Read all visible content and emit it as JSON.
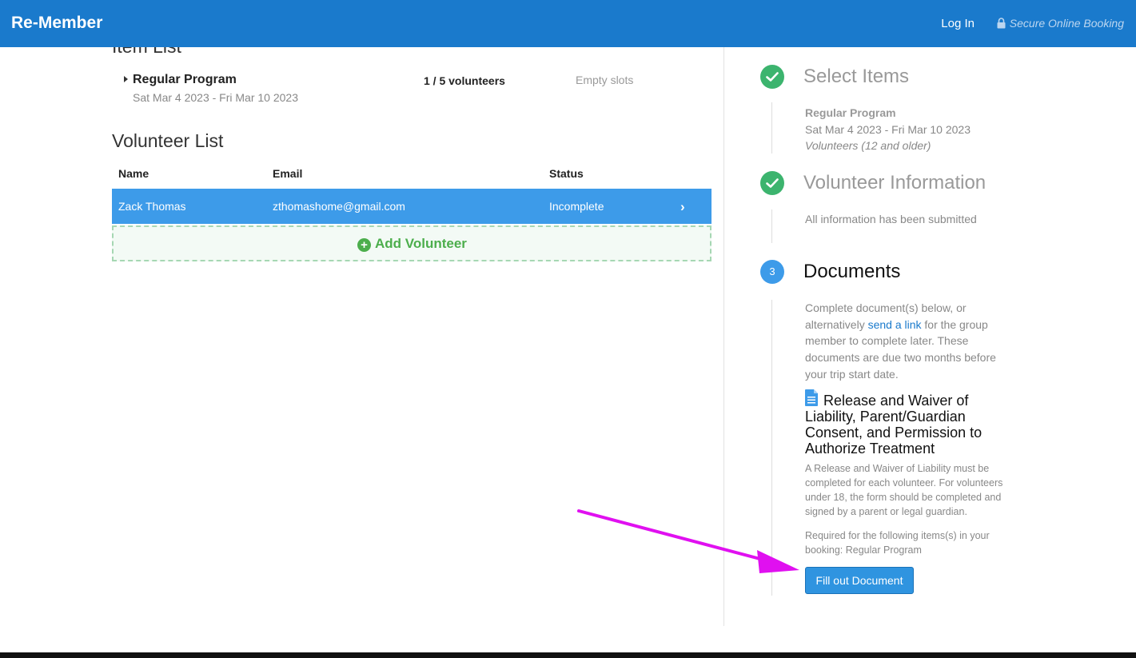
{
  "header": {
    "brand": "Re-Member",
    "login_label": "Log In",
    "secure_label": "Secure Online Booking"
  },
  "item_list": {
    "title": "Item List",
    "items": [
      {
        "name": "Regular Program",
        "dates": "Sat Mar 4 2023 - Fri Mar 10 2023",
        "count": "1 / 5 volunteers",
        "slots": "Empty slots"
      }
    ]
  },
  "volunteer_list": {
    "title": "Volunteer List",
    "columns": [
      "Name",
      "Email",
      "Status"
    ],
    "rows": [
      {
        "name": "Zack Thomas",
        "email": "zthomashome@gmail.com",
        "status": "Incomplete"
      }
    ],
    "add_label": "Add Volunteer"
  },
  "steps": {
    "select_items": {
      "title": "Select Items",
      "program": "Regular Program",
      "dates": "Sat Mar 4 2023 - Fri Mar 10 2023",
      "note": "Volunteers (12 and older)"
    },
    "volunteer_info": {
      "title": "Volunteer Information",
      "status": "All information has been submitted"
    },
    "documents": {
      "number": "3",
      "title": "Documents",
      "intro_a": "Complete document(s) below, or alternatively ",
      "intro_link": "send a link",
      "intro_b": " for the group member to complete later. These documents are due two months before your trip start date.",
      "doc_title": "Release and Waiver of Liability, Parent/Guardian Consent, and Permission to Authorize Treatment",
      "doc_desc": "A Release and Waiver of Liability must be completed for each volunteer. For volunteers under 18, the form should be completed and signed by a parent or legal guardian.",
      "doc_req": "Required for the following items(s) in your booking: Regular Program",
      "button_label": "Fill out Document"
    }
  },
  "colors": {
    "header": "#1a7acc",
    "selected_row": "#3d9be9",
    "success": "#3cb46e",
    "annotation_arrow": "#e010f0"
  }
}
